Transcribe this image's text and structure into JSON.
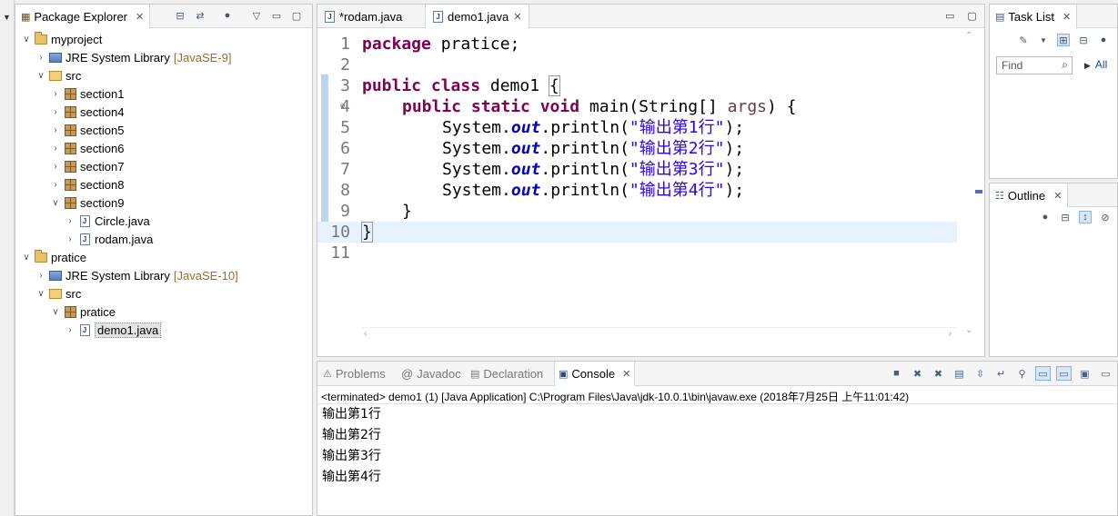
{
  "package_explorer": {
    "title": "Package Explorer",
    "items": [
      {
        "label": "myproject",
        "deco": "",
        "icon": "project-icon",
        "arrow": "v"
      },
      {
        "label": "JRE System Library",
        "deco": "[JavaSE-9]",
        "icon": "library-icon",
        "arrow": ">"
      },
      {
        "label": "src",
        "deco": "",
        "icon": "source-folder-icon",
        "arrow": "v"
      },
      {
        "label": "section1",
        "deco": "",
        "icon": "package-icon",
        "arrow": ">"
      },
      {
        "label": "section4",
        "deco": "",
        "icon": "package-icon",
        "arrow": ">"
      },
      {
        "label": "section5",
        "deco": "",
        "icon": "package-icon",
        "arrow": ">"
      },
      {
        "label": "section6",
        "deco": "",
        "icon": "package-icon",
        "arrow": ">"
      },
      {
        "label": "section7",
        "deco": "",
        "icon": "package-icon",
        "arrow": ">"
      },
      {
        "label": "section8",
        "deco": "",
        "icon": "package-icon",
        "arrow": ">"
      },
      {
        "label": "section9",
        "deco": "",
        "icon": "package-icon",
        "arrow": "v"
      },
      {
        "label": "Circle.java",
        "deco": "",
        "icon": "java-file-icon",
        "arrow": ">"
      },
      {
        "label": "rodam.java",
        "deco": "",
        "icon": "java-file-icon",
        "arrow": ">"
      },
      {
        "label": "pratice",
        "deco": "",
        "icon": "project-icon",
        "arrow": "v"
      },
      {
        "label": "JRE System Library",
        "deco": "[JavaSE-10]",
        "icon": "library-icon",
        "arrow": ">"
      },
      {
        "label": "src",
        "deco": "",
        "icon": "source-folder-icon",
        "arrow": "v"
      },
      {
        "label": "pratice",
        "deco": "",
        "icon": "package-icon",
        "arrow": "v"
      },
      {
        "label": "demo1.java",
        "deco": "",
        "icon": "java-file-icon",
        "arrow": ">"
      }
    ]
  },
  "editor": {
    "tabs": [
      {
        "label": "*rodam.java"
      },
      {
        "label": "demo1.java"
      }
    ],
    "line_numbers": [
      "1",
      "2",
      "3",
      "4",
      "5",
      "6",
      "7",
      "8",
      "9",
      "10",
      "11"
    ],
    "code": {
      "l1_kw": "package",
      "l1_rest": " pratice;",
      "l3_kw": "public class",
      "l3_rest": " demo1 ",
      "l3_brace": "{",
      "l4_kw": "public static void",
      "l4_rest": " main(String[] ",
      "l4_var": "args",
      "l4_end": ") {",
      "sys": "System.",
      "out": "out",
      "println": ".println(",
      "s5": "\"输出第1行\"",
      "s6": "\"输出第2行\"",
      "s7": "\"输出第3行\"",
      "s8": "\"输出第4行\"",
      "stmt_end": ");",
      "l9": "}",
      "l10": "}"
    }
  },
  "task_list": {
    "title": "Task List",
    "find_placeholder": "Find",
    "all_label": "All"
  },
  "outline": {
    "title": "Outline"
  },
  "console": {
    "tabs": [
      {
        "label": "Problems"
      },
      {
        "label": "Javadoc"
      },
      {
        "label": "Declaration"
      },
      {
        "label": "Console"
      }
    ],
    "terminated": "<terminated> demo1 (1) [Java Application] C:\\Program Files\\Java\\jdk-10.0.1\\bin\\javaw.exe (2018年7月25日 上午11:01:42)",
    "output": [
      "输出第1行",
      "输出第2行",
      "输出第3行",
      "输出第4行"
    ]
  }
}
